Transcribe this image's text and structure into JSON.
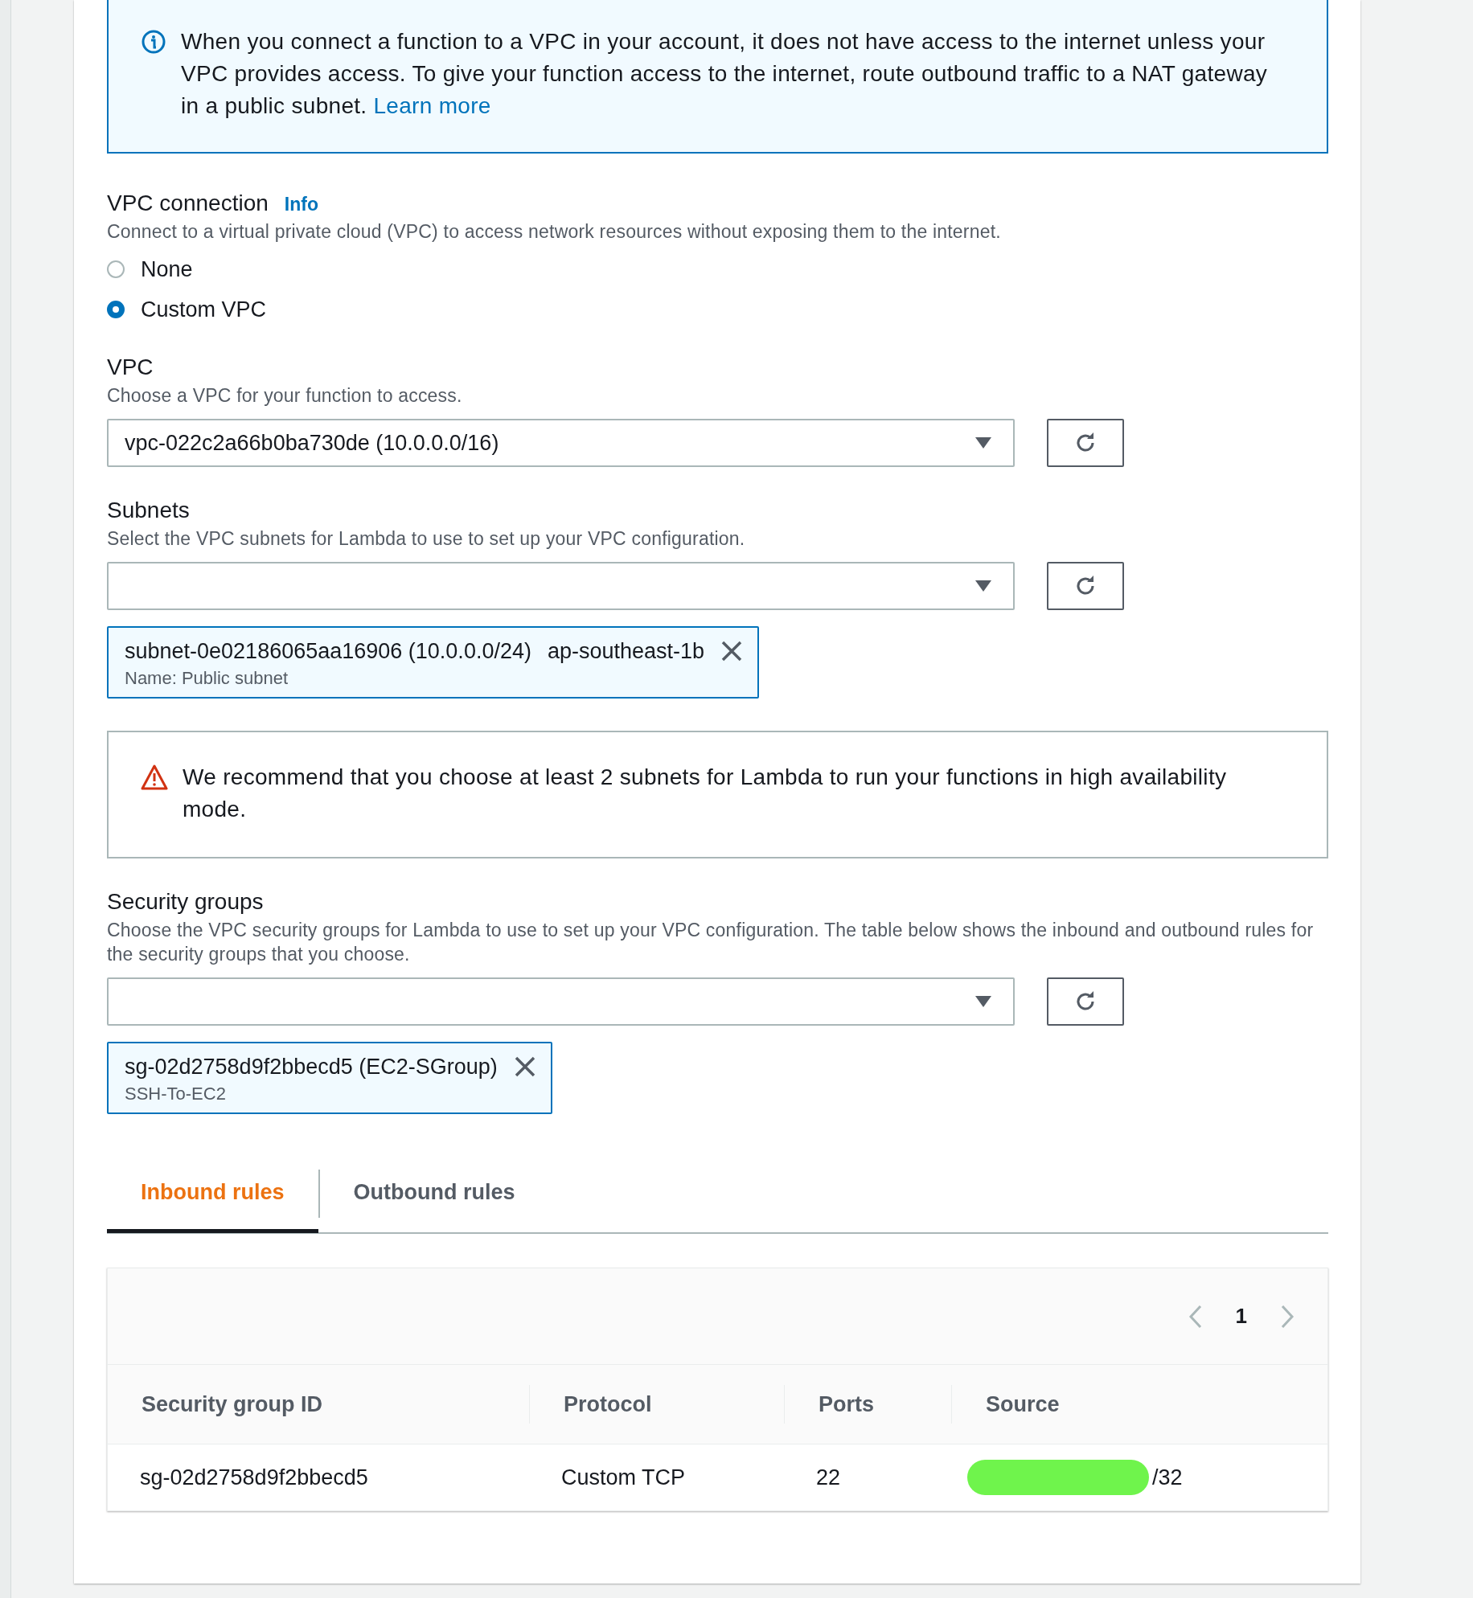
{
  "info_alert": {
    "text": "When you connect a function to a VPC in your account, it does not have access to the internet unless your VPC provides access. To give your function access to the internet, route outbound traffic to a NAT gateway in a public subnet.",
    "link": "Learn more"
  },
  "vpc_connection": {
    "label": "VPC connection",
    "info": "Info",
    "description": "Connect to a virtual private cloud (VPC) to access network resources without exposing them to the internet.",
    "options": [
      {
        "label": "None",
        "selected": false
      },
      {
        "label": "Custom VPC",
        "selected": true
      }
    ]
  },
  "vpc": {
    "label": "VPC",
    "description": "Choose a VPC for your function to access.",
    "value": "vpc-022c2a66b0ba730de (10.0.0.0/16)"
  },
  "subnets": {
    "label": "Subnets",
    "description": "Select the VPC subnets for Lambda to use to set up your VPC configuration.",
    "tokens": [
      {
        "title": "subnet-0e02186065aa16906 (10.0.0.0/24)",
        "tag": "ap-southeast-1b",
        "subtitle": "Name: Public subnet"
      }
    ]
  },
  "warning_alert": {
    "text": "We recommend that you choose at least 2 subnets for Lambda to run your functions in high availability mode."
  },
  "security_groups": {
    "label": "Security groups",
    "description": "Choose the VPC security groups for Lambda to use to set up your VPC configuration. The table below shows the inbound and outbound rules for the security groups that you choose.",
    "tokens": [
      {
        "title": "sg-02d2758d9f2bbecd5 (EC2-SGroup)",
        "subtitle": "SSH-To-EC2"
      }
    ]
  },
  "tabs": [
    {
      "label": "Inbound rules",
      "selected": true
    },
    {
      "label": "Outbound rules",
      "selected": false
    }
  ],
  "pagination": {
    "page": "1"
  },
  "table": {
    "columns": [
      "Security group ID",
      "Protocol",
      "Ports",
      "Source"
    ],
    "rows": [
      {
        "cells": [
          "sg-02d2758d9f2bbecd5",
          "Custom TCP",
          "22",
          "/32"
        ],
        "redacted": true
      }
    ]
  }
}
